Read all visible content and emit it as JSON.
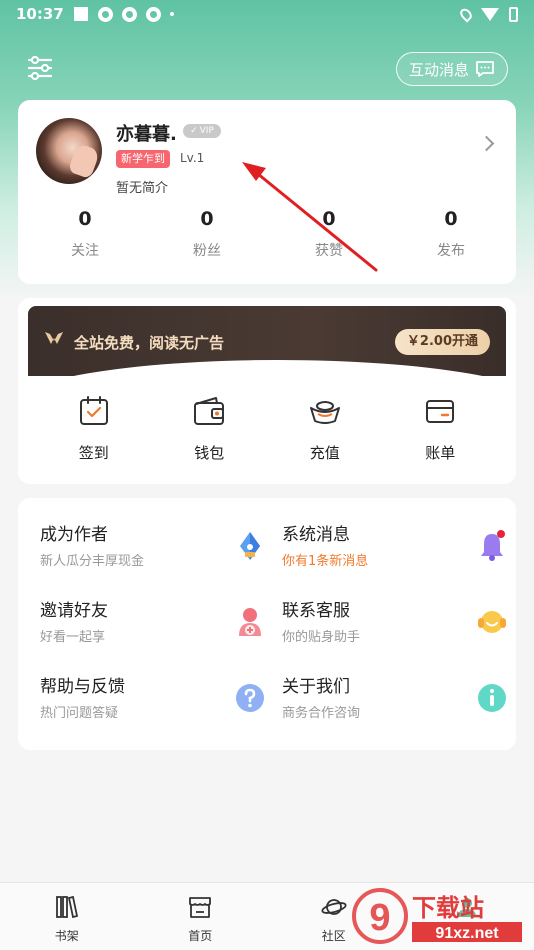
{
  "status_bar": {
    "time": "10:37"
  },
  "header": {
    "messages_label": "互动消息"
  },
  "profile": {
    "name": "亦暮暮.",
    "vip_tag": "VIP",
    "title_badge": "新学乍到",
    "level": "Lv.1",
    "bio": "暂无简介",
    "stats": [
      {
        "value": "0",
        "label": "关注"
      },
      {
        "value": "0",
        "label": "粉丝"
      },
      {
        "value": "0",
        "label": "获赞"
      },
      {
        "value": "0",
        "label": "发布"
      }
    ]
  },
  "vip_promo": {
    "text": "全站免费，阅读无广告",
    "button_label": "￥2.00开通"
  },
  "quick_actions": [
    {
      "label": "签到",
      "icon": "calendar-check-icon"
    },
    {
      "label": "钱包",
      "icon": "wallet-icon"
    },
    {
      "label": "充值",
      "icon": "gold-ingot-icon"
    },
    {
      "label": "账单",
      "icon": "card-icon"
    }
  ],
  "menu": [
    {
      "title": "成为作者",
      "subtitle": "新人瓜分丰厚现金",
      "icon": "pen-nib-icon"
    },
    {
      "title": "系统消息",
      "subtitle": "你有1条新消息",
      "icon": "bell-icon",
      "alert": true
    },
    {
      "title": "邀请好友",
      "subtitle": "好看一起享",
      "icon": "person-add-icon"
    },
    {
      "title": "联系客服",
      "subtitle": "你的贴身助手",
      "icon": "headset-icon"
    },
    {
      "title": "帮助与反馈",
      "subtitle": "热门问题答疑",
      "icon": "question-icon"
    },
    {
      "title": "关于我们",
      "subtitle": "商务合作咨询",
      "icon": "info-icon"
    }
  ],
  "tabbar": [
    {
      "label": "书架",
      "icon": "bookshelf-icon"
    },
    {
      "label": "首页",
      "icon": "store-icon"
    },
    {
      "label": "社区",
      "icon": "planet-icon"
    },
    {
      "label": "",
      "icon": "profile-icon"
    }
  ],
  "watermark": {
    "brand": "下载站",
    "domain": "91xz.net",
    "mark": "9"
  },
  "colors": {
    "accent": "#5fc3a3",
    "alert": "#f07a2c",
    "badge": "#f7656e",
    "arrow": "#e02020"
  }
}
